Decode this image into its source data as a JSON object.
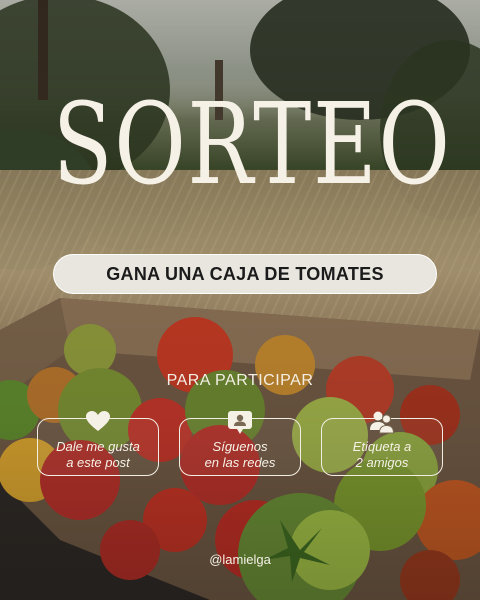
{
  "title": "SORTEO",
  "prize_label": "GANA UNA CAJA DE TOMATES",
  "participate_heading": "PARA PARTICIPAR",
  "steps": [
    {
      "icon": "heart-icon",
      "line1": "Dale me gusta",
      "line2": "a este post"
    },
    {
      "icon": "user-card-icon",
      "line1": "Síguenos",
      "line2": "en las redes"
    },
    {
      "icon": "users-icon",
      "line1": "Etiqueta a",
      "line2": "2 amigos"
    }
  ],
  "handle": "@lamielga",
  "colors": {
    "text": "#f6f1e6",
    "pill_bg": "#e9e6df",
    "pill_text": "#1b1b1b"
  }
}
